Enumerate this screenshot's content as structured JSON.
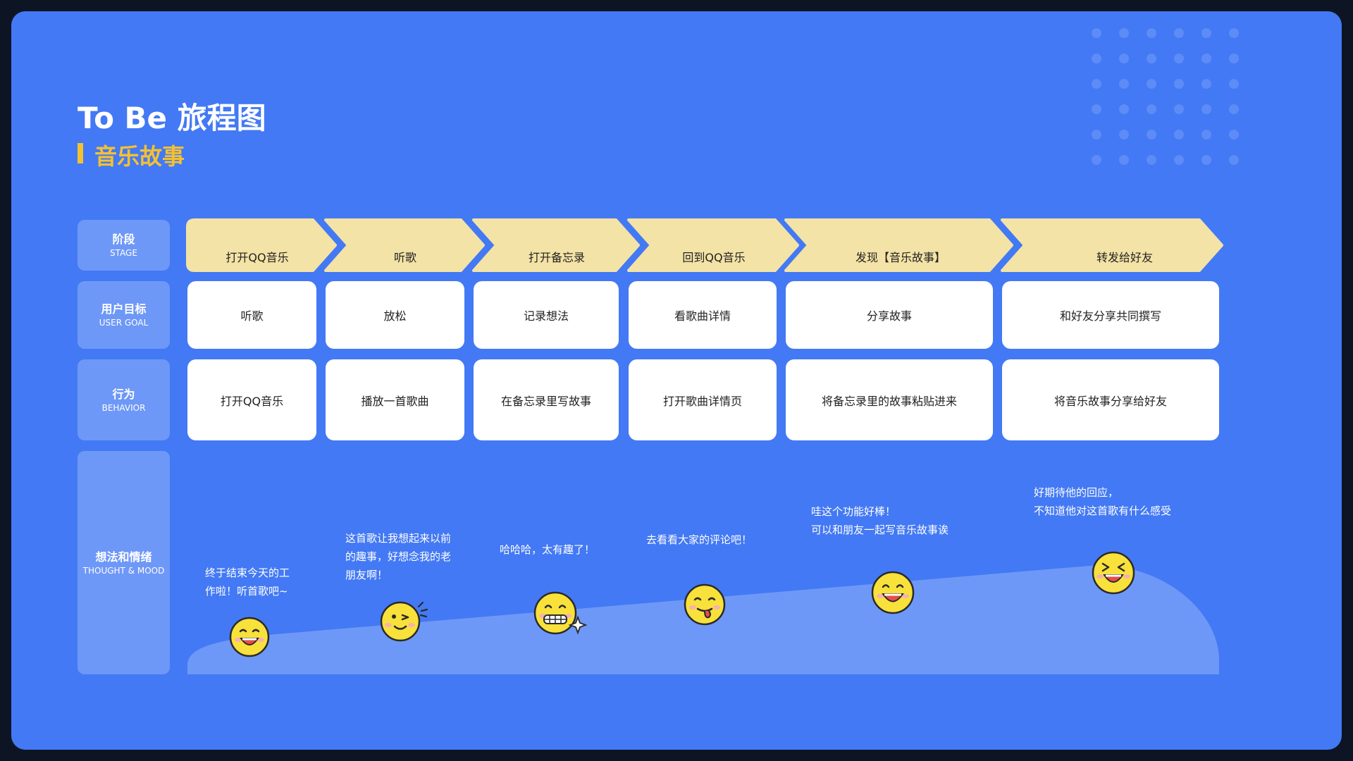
{
  "header": {
    "title": "To Be 旅程图",
    "subtitle": "音乐故事"
  },
  "rows": {
    "stage": {
      "cn": "阶段",
      "en": "STAGE"
    },
    "goal": {
      "cn": "用户目标",
      "en": "USER GOAL"
    },
    "behavior": {
      "cn": "行为",
      "en": "BEHAVIOR"
    },
    "thought": {
      "cn": "想法和情绪",
      "en": "THOUGHT & MOOD"
    }
  },
  "stages": [
    "打开QQ音乐",
    "听歌",
    "打开备忘录",
    "回到QQ音乐",
    "发现【音乐故事】",
    "转发给好友"
  ],
  "goals": [
    "听歌",
    "放松",
    "记录想法",
    "看歌曲详情",
    "分享故事",
    "和好友分享共同撰写"
  ],
  "behaviors": [
    "打开QQ音乐",
    "播放一首歌曲",
    "在备忘录里写故事",
    "打开歌曲详情页",
    "将备忘录里的故事粘贴进来",
    "将音乐故事分享给好友"
  ],
  "thoughts": [
    {
      "lines": [
        "终于结束今天的工",
        "作啦！听首歌吧~"
      ],
      "emotion": "happy"
    },
    {
      "lines": [
        "这首歌让我想起来以前",
        "的趣事，好想念我的老",
        "朋友啊！"
      ],
      "emotion": "wink"
    },
    {
      "lines": [
        "哈哈哈，太有趣了！"
      ],
      "emotion": "grin-sparkle"
    },
    {
      "lines": [
        "去看看大家的评论吧！"
      ],
      "emotion": "tongue"
    },
    {
      "lines": [
        "哇这个功能好棒！",
        "可以和朋友一起写音乐故事诶"
      ],
      "emotion": "happy"
    },
    {
      "lines": [
        "好期待他的回应，",
        "不知道他对这首歌有什么感受"
      ],
      "emotion": "laughing"
    }
  ],
  "colors": {
    "background": "#4379f4",
    "stage_arrow": "#f4e3a6",
    "accent": "#f5c131",
    "label_box": "#6e98f7",
    "emotion_curve": "#6e98f7",
    "face": "#f8e13a"
  }
}
